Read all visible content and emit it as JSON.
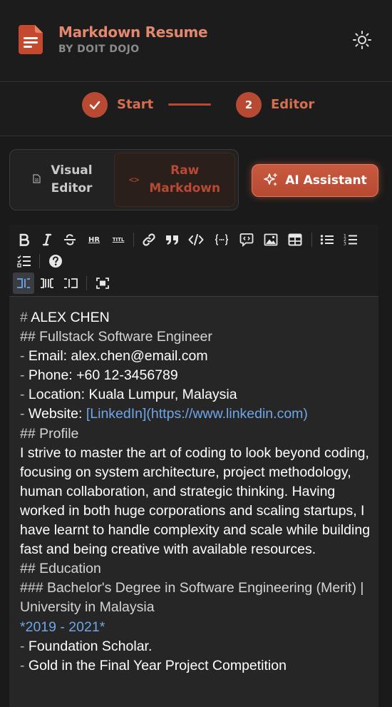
{
  "app": {
    "title": "Markdown Resume",
    "subtitle": "BY DOIT DOJO"
  },
  "steps": [
    {
      "number": "✓",
      "label": "Start",
      "state": "complete"
    },
    {
      "number": "2",
      "label": "Editor",
      "state": "active"
    }
  ],
  "modes": {
    "visual_label": "Visual\nEditor",
    "raw_label": "Raw\nMarkdown",
    "selected": "raw"
  },
  "ai_button": {
    "label": "AI Assistant"
  },
  "toolbar": {
    "items": [
      "bold-icon",
      "italic-icon",
      "strikethrough-icon",
      "hr-icon",
      "title-icon",
      "link-icon",
      "quote-icon",
      "code-icon",
      "code-block-icon",
      "comment-icon",
      "image-icon",
      "table-icon",
      "unordered-list-icon",
      "ordered-list-icon",
      "checklist-icon",
      "help-icon",
      "edit-mode-icon",
      "live-mode-icon",
      "preview-mode-icon",
      "fullscreen-icon"
    ],
    "hr_text": "HR",
    "title_text": "TITL"
  },
  "editor": {
    "lines": [
      {
        "prefix": "# ",
        "text": "ALEX CHEN"
      },
      {
        "prefix": "## ",
        "text": "Fullstack Software Engineer"
      },
      {
        "prefix": "- ",
        "text": "Email: alex.chen@email.com"
      },
      {
        "prefix": "- ",
        "text": "Phone: +60 12-3456789"
      },
      {
        "prefix": "- ",
        "text": "Location: Kuala Lumpur, Malaysia"
      },
      {
        "prefix": "- ",
        "text": "Website: ",
        "link": "[LinkedIn](https://www.linkedin.com)"
      },
      {
        "prefix": "## ",
        "text": "Profile"
      },
      {
        "prefix": "",
        "text": "I strive to master the art of coding to look beyond coding, focusing on system architecture, project methodology, human collaboration, and strategic thinking. Having worked in both huge corporations and scaling startups, I have learnt to handle complexity and scale while building fast and being creative with available resources."
      },
      {
        "prefix": "## ",
        "text": "Education"
      },
      {
        "prefix": "### ",
        "text": "Bachelor's Degree in Software Engineering (Merit) | University in Malaysia"
      },
      {
        "prefix": "*",
        "text": "2019 - 2021",
        "suffix": "*"
      },
      {
        "prefix": "- ",
        "text": "Foundation Scholar."
      },
      {
        "prefix": "- ",
        "text": "Gold in the Final Year Project Competition"
      }
    ]
  },
  "colors": {
    "accent": "#b84a33",
    "accent_text": "#d96d50",
    "link": "#6ea6e8",
    "background": "#1a1a1a"
  }
}
